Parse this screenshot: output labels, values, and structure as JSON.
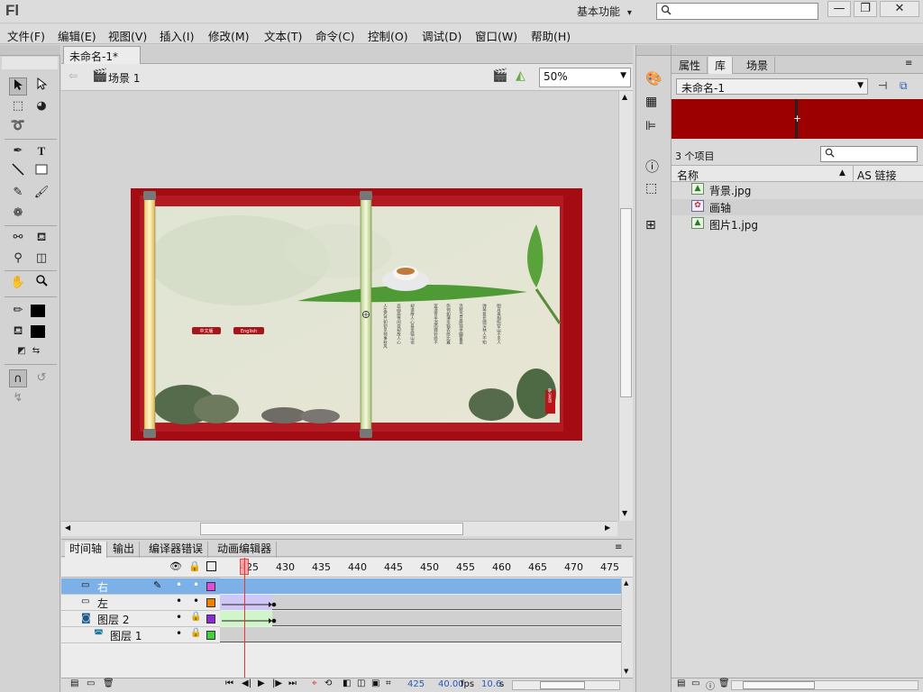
{
  "app": {
    "logo": "Fl",
    "workspace": "基本功能",
    "workspace_arrow": "▾"
  },
  "window_buttons": {
    "minimize": "—",
    "restore": "❐",
    "close": "✕"
  },
  "menu": [
    "文件(F)",
    "编辑(E)",
    "视图(V)",
    "插入(I)",
    "修改(M)",
    "文本(T)",
    "命令(C)",
    "控制(O)",
    "调试(D)",
    "窗口(W)",
    "帮助(H)"
  ],
  "document": {
    "tab_title": "未命名-1*",
    "tab_close": "×",
    "scene_label": "场景 1",
    "zoom": "50%"
  },
  "artwork": {
    "poem_lines": [
      "人生若只如初见何事秋风",
      "悲画扇等闲变却故人心",
      "却道故人心易变骊山语",
      "罢清宵半泪雨霖铃终不",
      "怨何如薄幸锦衣郎比翼",
      "连枝当日愿独坐幽篁里",
      "弹琴复长啸深林人不知",
      "明月来相照空山不见人"
    ],
    "button_labels": [
      "中文版",
      "English"
    ],
    "seal": "静心茶语"
  },
  "timeline": {
    "tabs": [
      "时间轴",
      "输出",
      "编译器错误",
      "动画编辑器"
    ],
    "ruler_labels": [
      "425",
      "430",
      "435",
      "440",
      "445",
      "450",
      "455",
      "460",
      "465",
      "470",
      "475"
    ],
    "layers": [
      {
        "name": "右",
        "selected": true,
        "color": "#e24be0"
      },
      {
        "name": "左",
        "selected": false,
        "color": "#f08000"
      },
      {
        "name": "图层 2",
        "selected": false,
        "color": "#8a2bd0"
      },
      {
        "name": "图层 1",
        "selected": false,
        "color": "#40d040"
      }
    ],
    "status": {
      "frame": "425",
      "fps": "40.00",
      "fps_unit": "fps",
      "time": "10.6",
      "time_unit": "s"
    }
  },
  "library": {
    "tabs": [
      "属性",
      "库",
      "场景"
    ],
    "document_select": "未命名-1",
    "item_count": "3 个项目",
    "columns": {
      "name": "名称",
      "linkage": "AS 链接"
    },
    "items": [
      {
        "name": "背景.jpg",
        "type": "bitmap"
      },
      {
        "name": "画轴",
        "type": "movieclip"
      },
      {
        "name": "图片1.jpg",
        "type": "bitmap"
      }
    ],
    "preview_color": "#9c0000"
  },
  "colors": {
    "stage_border": "#a50b12",
    "selection_row": "#7bb1e8",
    "playhead": "#e33"
  }
}
